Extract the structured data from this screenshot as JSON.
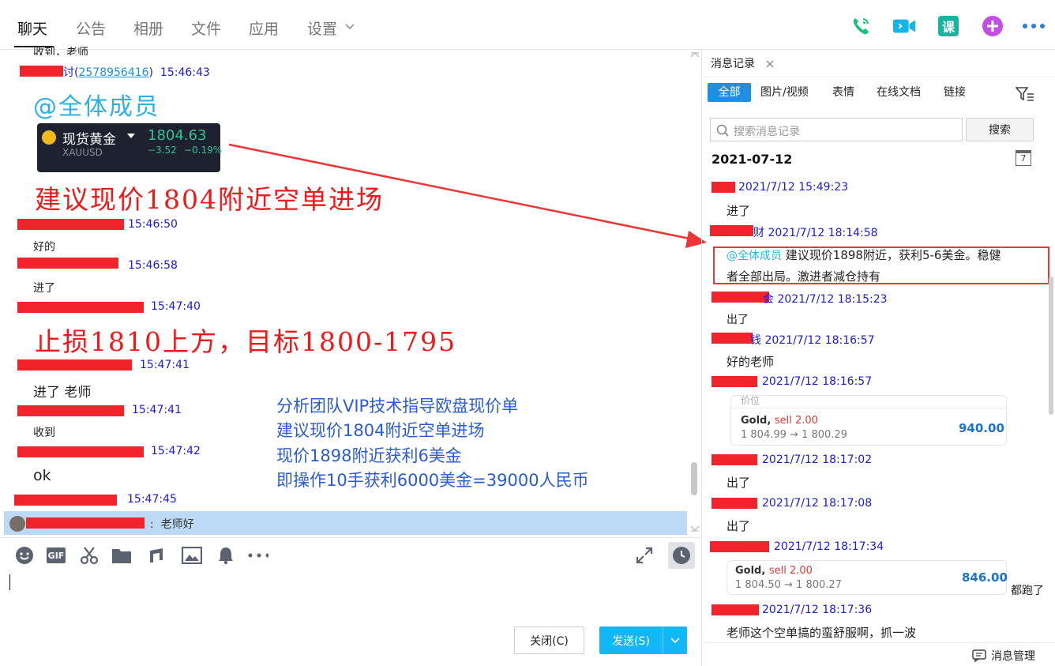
{
  "tabs": [
    "聊天",
    "公告",
    "相册",
    "文件",
    "应用",
    "设置"
  ],
  "chat": {
    "cut_top_text": "收到，老师",
    "msg1_suffix": "讨",
    "msg1_qq": "2578956416",
    "msg1_time": "15:46:43",
    "at_all": "@全体成员",
    "quote": {
      "name": "现货黄金",
      "code": "XAUUSD",
      "price": "1804.63",
      "change": "−3.52",
      "pct": "−0.19%"
    },
    "suggest_text": "建议现价1804附近空单进场",
    "m2_time": "15:46:50",
    "m2_body": "好的",
    "m3_time": "15:46:58",
    "m3_body": "进了",
    "m4_time": "15:47:40",
    "stop_text": "止损1810上方，目标1800-1795",
    "m5_time": "15:47:41",
    "m5_body": "进了 老师",
    "m6_time": "15:47:41",
    "m6_body": "收到",
    "m7_time": "15:47:42",
    "m7_body": "ok",
    "m8_time": "15:47:45",
    "selected_text": "老师好"
  },
  "annotation_lines": [
    "分析团队VIP技术指导欧盘现价单",
    "建议现价1804附近空单进场",
    "现价1898附近获利6美金",
    "即操作10手获利6000美金=39000人民币"
  ],
  "composer": {
    "close": "关闭(C)",
    "send": "发送(S)"
  },
  "right": {
    "tab_title": "消息记录",
    "categories": [
      "全部",
      "图片/视频",
      "表情",
      "在线文档",
      "链接"
    ],
    "search_placeholder": "搜索消息记录",
    "search_btn": "搜索",
    "date": "2021-07-12",
    "calendar_day": "7",
    "entries": [
      {
        "time": "2021/7/12 15:49:23",
        "body": "进了"
      },
      {
        "time": "2021/7/12 18:14:58",
        "at": "@全体成员",
        "body": "建议现价1898附近，获利5-6美金。稳健",
        "body2": "者全部出局。激进者减仓持有",
        "suffix": "财"
      },
      {
        "time": "2021/7/12 18:15:23",
        "body": "出了",
        "suffix": "会"
      },
      {
        "time": "2021/7/12 18:16:57",
        "body": "好的老师",
        "suffix": "钱"
      },
      {
        "time": "2021/7/12 18:16:57"
      },
      {
        "time": "2021/7/12 18:17:02",
        "body": "出了"
      },
      {
        "time": "2021/7/12 18:17:08",
        "body": "出了"
      },
      {
        "time": "2021/7/12 18:17:34"
      },
      {
        "time": "2021/7/12 18:17:36",
        "body": "老师这个空单搞的蛮舒服啊，抓一波"
      }
    ],
    "trade1": {
      "header": "价位",
      "symbol": "Gold,",
      "side": "sell 2.00",
      "prices": "1 804.99 → 1 800.29",
      "profit": "940.00"
    },
    "trade2": {
      "symbol": "Gold,",
      "side": "sell 2.00",
      "prices": "1 804.50 → 1 800.27",
      "profit": "846.00"
    },
    "all_ran": "都跑了",
    "manage": "消息管理"
  },
  "colors": {
    "accent": "#1f8fe6",
    "red": "#f01818",
    "annotation_blue": "#2a5bd7",
    "selected_row": "#bcd9f5"
  }
}
